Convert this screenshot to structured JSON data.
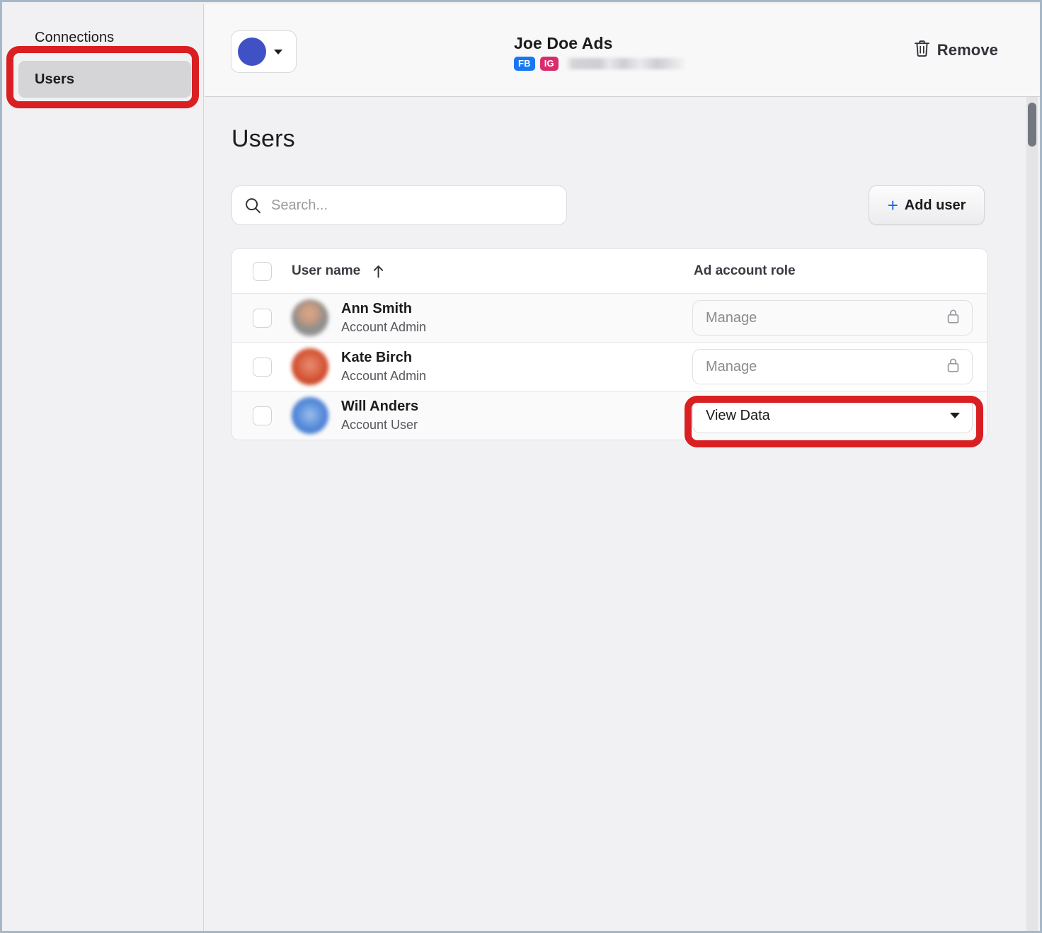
{
  "sidebar": {
    "section_label": "Connections",
    "active_item": "Users"
  },
  "header": {
    "account_name": "Joe Doe Ads",
    "badges": [
      {
        "label": "FB",
        "color": "#1877f2"
      },
      {
        "label": "IG",
        "color": "#d92d6b"
      }
    ],
    "avatar_color": "#3f51c4",
    "remove_label": "Remove"
  },
  "main": {
    "page_title": "Users",
    "search": {
      "value": "",
      "placeholder": "Search..."
    },
    "add_user_label": "Add user",
    "table": {
      "columns": {
        "user_name": "User name",
        "ad_account_role": "Ad account role"
      },
      "sort": {
        "column": "User name",
        "direction": "ascending"
      },
      "rows": [
        {
          "name": "Ann Smith",
          "role_text": "Account Admin",
          "ad_account_role": "Manage",
          "locked": true,
          "selected": false,
          "avatar_class": "avatar-ann"
        },
        {
          "name": "Kate Birch",
          "role_text": "Account Admin",
          "ad_account_role": "Manage",
          "locked": true,
          "selected": false,
          "avatar_class": "avatar-kate"
        },
        {
          "name": "Will Anders",
          "role_text": "Account User",
          "ad_account_role": "View Data",
          "locked": false,
          "selected": false,
          "avatar_class": "avatar-will"
        }
      ]
    }
  },
  "annotations": {
    "color": "#d91f22",
    "targets": [
      "sidebar-item-users",
      "role-select-will-anders"
    ]
  }
}
